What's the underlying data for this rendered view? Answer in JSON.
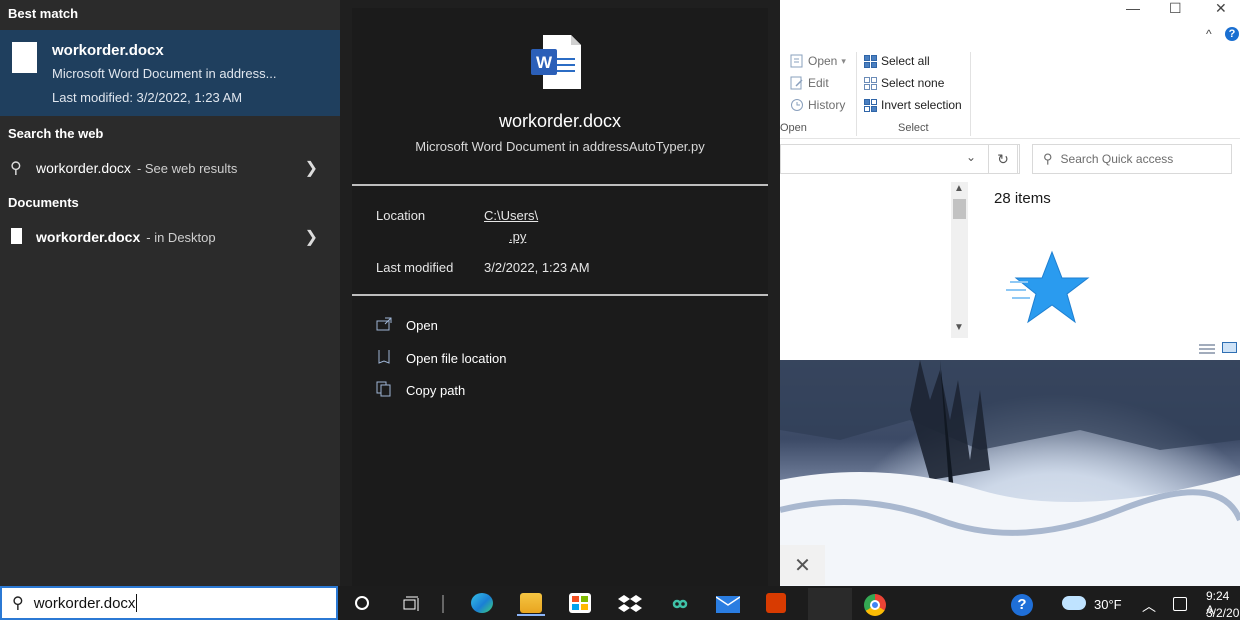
{
  "explorer": {
    "controls": {
      "minimize": "—",
      "maximize": "☐",
      "close": "✕",
      "expand": "^",
      "help": "?"
    },
    "ribbon": {
      "open_group": {
        "open": "Open",
        "edit": "Edit",
        "history": "History",
        "caption": "Open"
      },
      "select_group": {
        "select_all": "Select all",
        "select_none": "Select none",
        "invert_selection": "Invert selection",
        "caption": "Select"
      }
    },
    "search_placeholder": "Search Quick access",
    "items_count": "28 items"
  },
  "search": {
    "best_match_heading": "Best match",
    "best_match": {
      "name": "workorder.docx",
      "type": "Microsoft Word Document in address...",
      "modified": "Last modified: 3/2/2022, 1:23 AM"
    },
    "web_heading": "Search the web",
    "web_result": {
      "term": "workorder.docx",
      "suffix": "- See web results"
    },
    "documents_heading": "Documents",
    "doc_result": {
      "name": "workorder.docx",
      "suffix": "- in Desktop"
    },
    "query": "workorder.docx"
  },
  "preview": {
    "file_name": "workorder.docx",
    "file_desc": "Microsoft Word Document in addressAutoTyper.py",
    "location_label": "Location",
    "location_line1": "C:\\Users\\",
    "location_line2": ".py",
    "modified_label": "Last modified",
    "modified_value": "3/2/2022, 1:23 AM",
    "actions": [
      "Open",
      "Open file location",
      "Copy path"
    ]
  },
  "taskbar": {
    "weather": "30°F",
    "time": "9:24 A",
    "date": "3/2/20"
  },
  "colors": {
    "accent_blue": "#2b79d4",
    "best_match_bg": "#1f3f5e"
  }
}
